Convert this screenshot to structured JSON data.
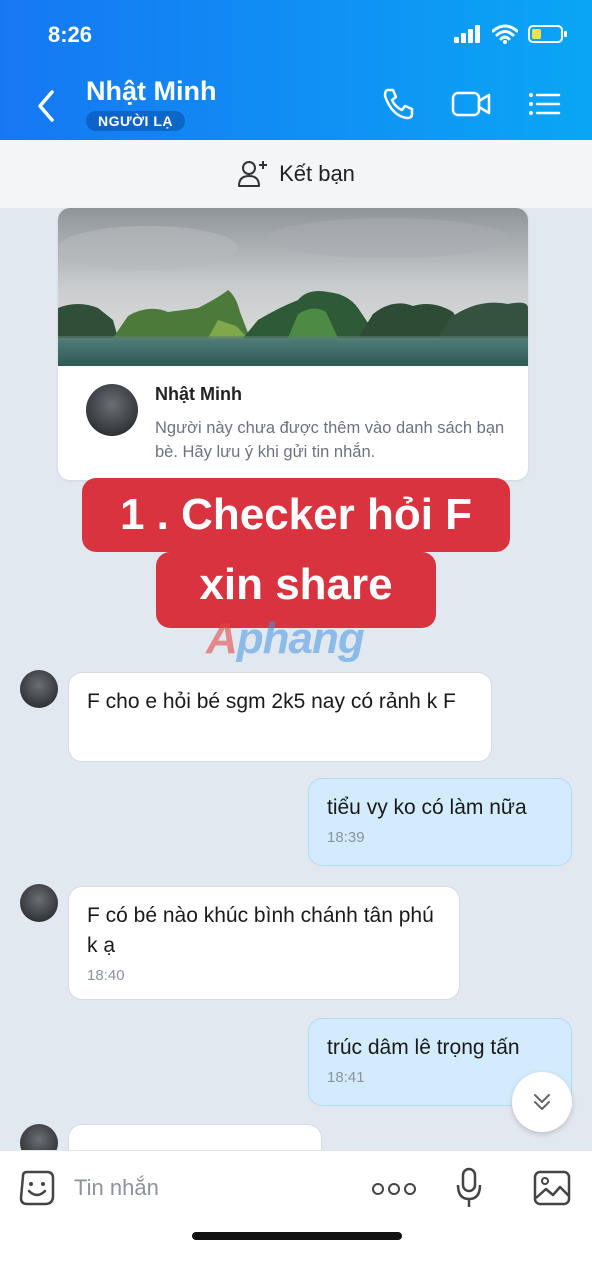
{
  "status": {
    "time": "8:26"
  },
  "header": {
    "contact_name": "Nhật Minh",
    "badge": "NGƯỜI LẠ"
  },
  "friend_bar": {
    "label": "Kết bạn"
  },
  "profile_card": {
    "name": "Nhật Minh",
    "note": "Người này chưa được thêm vào danh sách bạn bè. Hãy lưu ý khi gửi tin nhắn."
  },
  "overlay": {
    "line1": "1 . Checker hỏi F",
    "line2": "xin share",
    "watermark_a": "A",
    "watermark_b": "phang"
  },
  "messages": [
    {
      "direction": "in",
      "text": "F cho e hỏi bé sgm 2k5 nay có rảnh k F",
      "time": ""
    },
    {
      "direction": "out",
      "text": "tiểu vy ko có làm nữa",
      "time": "18:39"
    },
    {
      "direction": "in",
      "text": "F có bé nào khúc bình chánh tân phú k ạ",
      "time": "18:40"
    },
    {
      "direction": "out",
      "text": "trúc dâm lê trọng tấn",
      "time": "18:41"
    }
  ],
  "composer": {
    "placeholder": "Tin nhắn"
  },
  "icons": {
    "back": "chevron-left-icon",
    "call": "phone-icon",
    "video": "video-camera-icon",
    "menu": "list-menu-icon",
    "add_friend": "add-user-icon",
    "sticker": "sticker-face-icon",
    "more": "more-dots-icon",
    "mic": "microphone-icon",
    "image": "image-icon",
    "scroll_down": "double-chevron-down-icon"
  },
  "colors": {
    "header_start": "#1677f3",
    "header_end": "#0aa6f5",
    "outgoing_bubble": "#d3ecfd",
    "banner": "#d9333f"
  }
}
